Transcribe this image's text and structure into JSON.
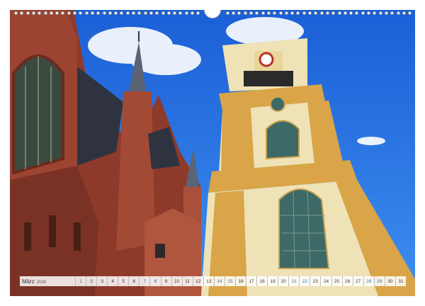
{
  "calendar": {
    "month": "März",
    "year": "2026",
    "days": [
      "1",
      "2",
      "3",
      "4",
      "5",
      "6",
      "7",
      "8",
      "9",
      "10",
      "11",
      "12",
      "13",
      "14",
      "15",
      "16",
      "17",
      "18",
      "19",
      "20",
      "21",
      "22",
      "23",
      "24",
      "25",
      "26",
      "27",
      "28",
      "29",
      "30",
      "31"
    ],
    "weekend_days": [
      "1",
      "7",
      "8",
      "14",
      "15",
      "21",
      "22",
      "28",
      "29"
    ]
  },
  "photo": {
    "subject": "",
    "colors": {
      "sky": "#1f6fe0",
      "brick": "#8e3a2a",
      "tower_cream": "#efe2b6",
      "tower_ochre": "#d9a548",
      "spire": "#5a6475"
    }
  }
}
